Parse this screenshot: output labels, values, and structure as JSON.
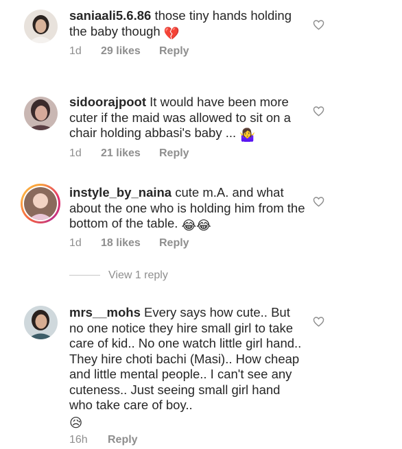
{
  "comments": [
    {
      "username": "saniaali5.6.86",
      "text": "those tiny hands holding the baby though",
      "emoji": "💔",
      "time": "1d",
      "likes": "29 likes",
      "reply": "Reply"
    },
    {
      "username": "sidoorajpoot",
      "text": "It would have been more cuter if the maid was allowed to sit on a chair holding abbasi's baby ...",
      "emoji": "🤷‍♀️",
      "time": "1d",
      "likes": "21 likes",
      "reply": "Reply"
    },
    {
      "username": "instyle_by_naina",
      "text": "cute m.A. and what about the one who is holding him from the bottom of the table.",
      "emoji": "😂😂",
      "time": "1d",
      "likes": "18 likes",
      "reply": "Reply"
    },
    {
      "username": "mrs__mohs",
      "text": "Every says how cute.. But no one notice they hire small girl to take care of kid.. No one watch little girl hand.. They hire choti bachi (Masi).. How cheap and little mental people.. I can't see any cuteness.. Just seeing small girl hand who take care of boy..",
      "emoji": "😥",
      "time": "16h",
      "reply": "Reply"
    }
  ],
  "view_replies": "View 1 reply",
  "icons": {
    "like": "heart-outline-icon"
  },
  "colors": {
    "text": "#262626",
    "meta": "#8e8e8e",
    "heart_stroke": "#8e8e8e"
  }
}
